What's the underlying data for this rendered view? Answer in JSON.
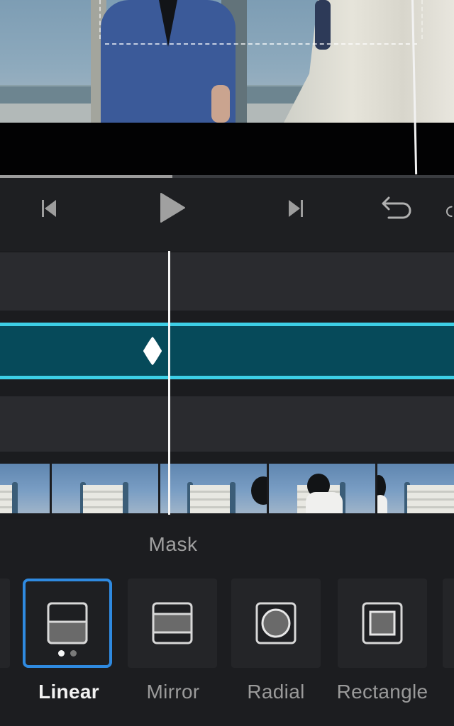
{
  "preview": {
    "playback_progress": 0.38
  },
  "transport": {
    "buttons": [
      {
        "name": "skip-to-start",
        "icon": "skip-back-icon"
      },
      {
        "name": "play",
        "icon": "play-icon"
      },
      {
        "name": "skip-to-end",
        "icon": "skip-forward-icon"
      },
      {
        "name": "undo",
        "icon": "undo-icon"
      },
      {
        "name": "redo",
        "icon": "redo-icon"
      }
    ]
  },
  "timeline": {
    "keyframe_icon": "keyframe-diamond-icon",
    "track_color": "#064a5a",
    "track_border_color": "#3dcfe6"
  },
  "mask_panel": {
    "title": "Mask",
    "selected": "Linear",
    "accent_color": "#2f8ae0",
    "options": [
      {
        "label": "Linear",
        "icon": "linear-mask-icon",
        "selected": true,
        "page_dots": 2,
        "active_dot": 1
      },
      {
        "label": "Mirror",
        "icon": "mirror-mask-icon",
        "selected": false
      },
      {
        "label": "Radial",
        "icon": "radial-mask-icon",
        "selected": false
      },
      {
        "label": "Rectangle",
        "icon": "rectangle-mask-icon",
        "selected": false
      }
    ]
  }
}
